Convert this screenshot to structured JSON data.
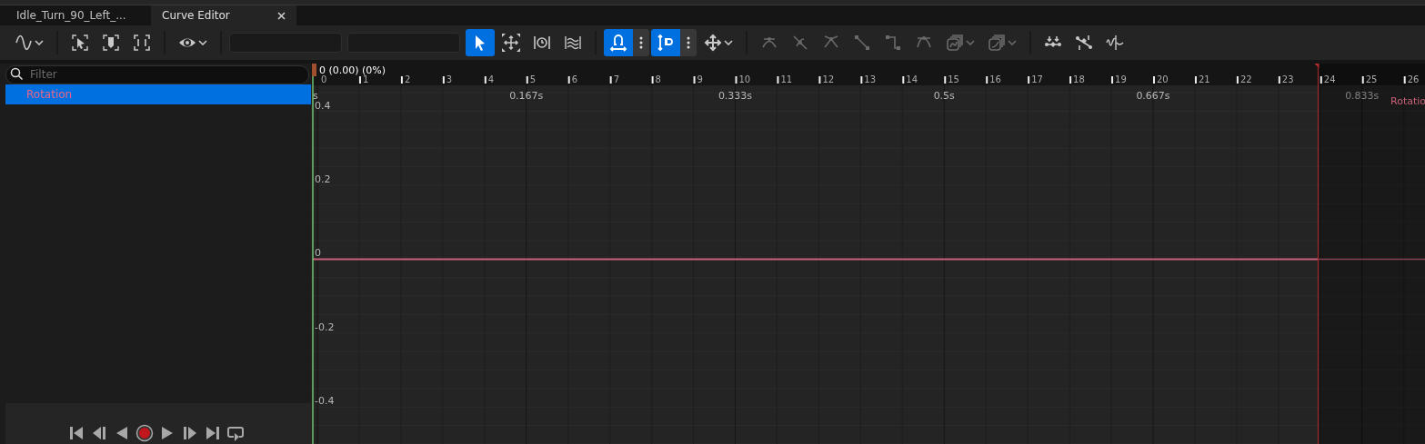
{
  "tabs": [
    {
      "label": "Idle_Turn_90_Left_...",
      "selected": false,
      "closable": false
    },
    {
      "label": "Curve Editor",
      "selected": true,
      "closable": true
    }
  ],
  "toolbar": [
    {
      "kind": "dropdown",
      "selected": false,
      "disabled": false
    },
    {
      "kind": "separator"
    },
    {
      "kind": "button",
      "selected": false,
      "disabled": false
    },
    {
      "kind": "button",
      "selected": false,
      "disabled": false
    },
    {
      "kind": "button",
      "selected": false,
      "disabled": false
    },
    {
      "kind": "separator"
    },
    {
      "kind": "dropdown",
      "selected": false,
      "disabled": false
    },
    {
      "kind": "separator"
    },
    {
      "kind": "field"
    },
    {
      "kind": "field"
    },
    {
      "kind": "button",
      "selected": true,
      "disabled": false
    },
    {
      "kind": "button",
      "selected": false,
      "disabled": false
    },
    {
      "kind": "button",
      "selected": false,
      "disabled": false
    },
    {
      "kind": "button",
      "selected": false,
      "disabled": false
    },
    {
      "kind": "separator"
    },
    {
      "kind": "split",
      "selected": true,
      "disabled": false
    },
    {
      "kind": "split",
      "selected": true,
      "disabled": false
    },
    {
      "kind": "dropdown",
      "selected": false,
      "disabled": false
    },
    {
      "kind": "separator"
    },
    {
      "kind": "button",
      "selected": false,
      "disabled": true
    },
    {
      "kind": "button",
      "selected": false,
      "disabled": true
    },
    {
      "kind": "button",
      "selected": false,
      "disabled": true
    },
    {
      "kind": "button",
      "selected": false,
      "disabled": true
    },
    {
      "kind": "button",
      "selected": false,
      "disabled": true
    },
    {
      "kind": "button",
      "selected": false,
      "disabled": true
    },
    {
      "kind": "dropdown",
      "selected": false,
      "disabled": true
    },
    {
      "kind": "dropdown",
      "selected": false,
      "disabled": true
    },
    {
      "kind": "separator"
    },
    {
      "kind": "button",
      "selected": false,
      "disabled": false
    },
    {
      "kind": "button",
      "selected": false,
      "disabled": false
    },
    {
      "kind": "button",
      "selected": false,
      "disabled": false
    }
  ],
  "filter": {
    "placeholder": "Filter"
  },
  "curves": [
    {
      "label": "Rotation",
      "selected": true,
      "color": "#e8668a"
    }
  ],
  "graph": {
    "playhead_label": "0 (0.00) (0%)",
    "frames": [
      "0",
      "1",
      "2",
      "3",
      "4",
      "5",
      "6",
      "7",
      "8",
      "9",
      "10",
      "11",
      "12",
      "13",
      "14",
      "15",
      "16",
      "17",
      "18",
      "19",
      "20",
      "21",
      "22",
      "23",
      "24",
      "25",
      "26"
    ],
    "time_labels": [
      "s",
      "0.167s",
      "0.333s",
      "0.5s",
      "0.667s",
      "0.833s"
    ],
    "value_labels": [
      "0.4",
      "0.2",
      "0",
      "-0.2",
      "-0.4"
    ],
    "curve_label": "Rotatio"
  }
}
